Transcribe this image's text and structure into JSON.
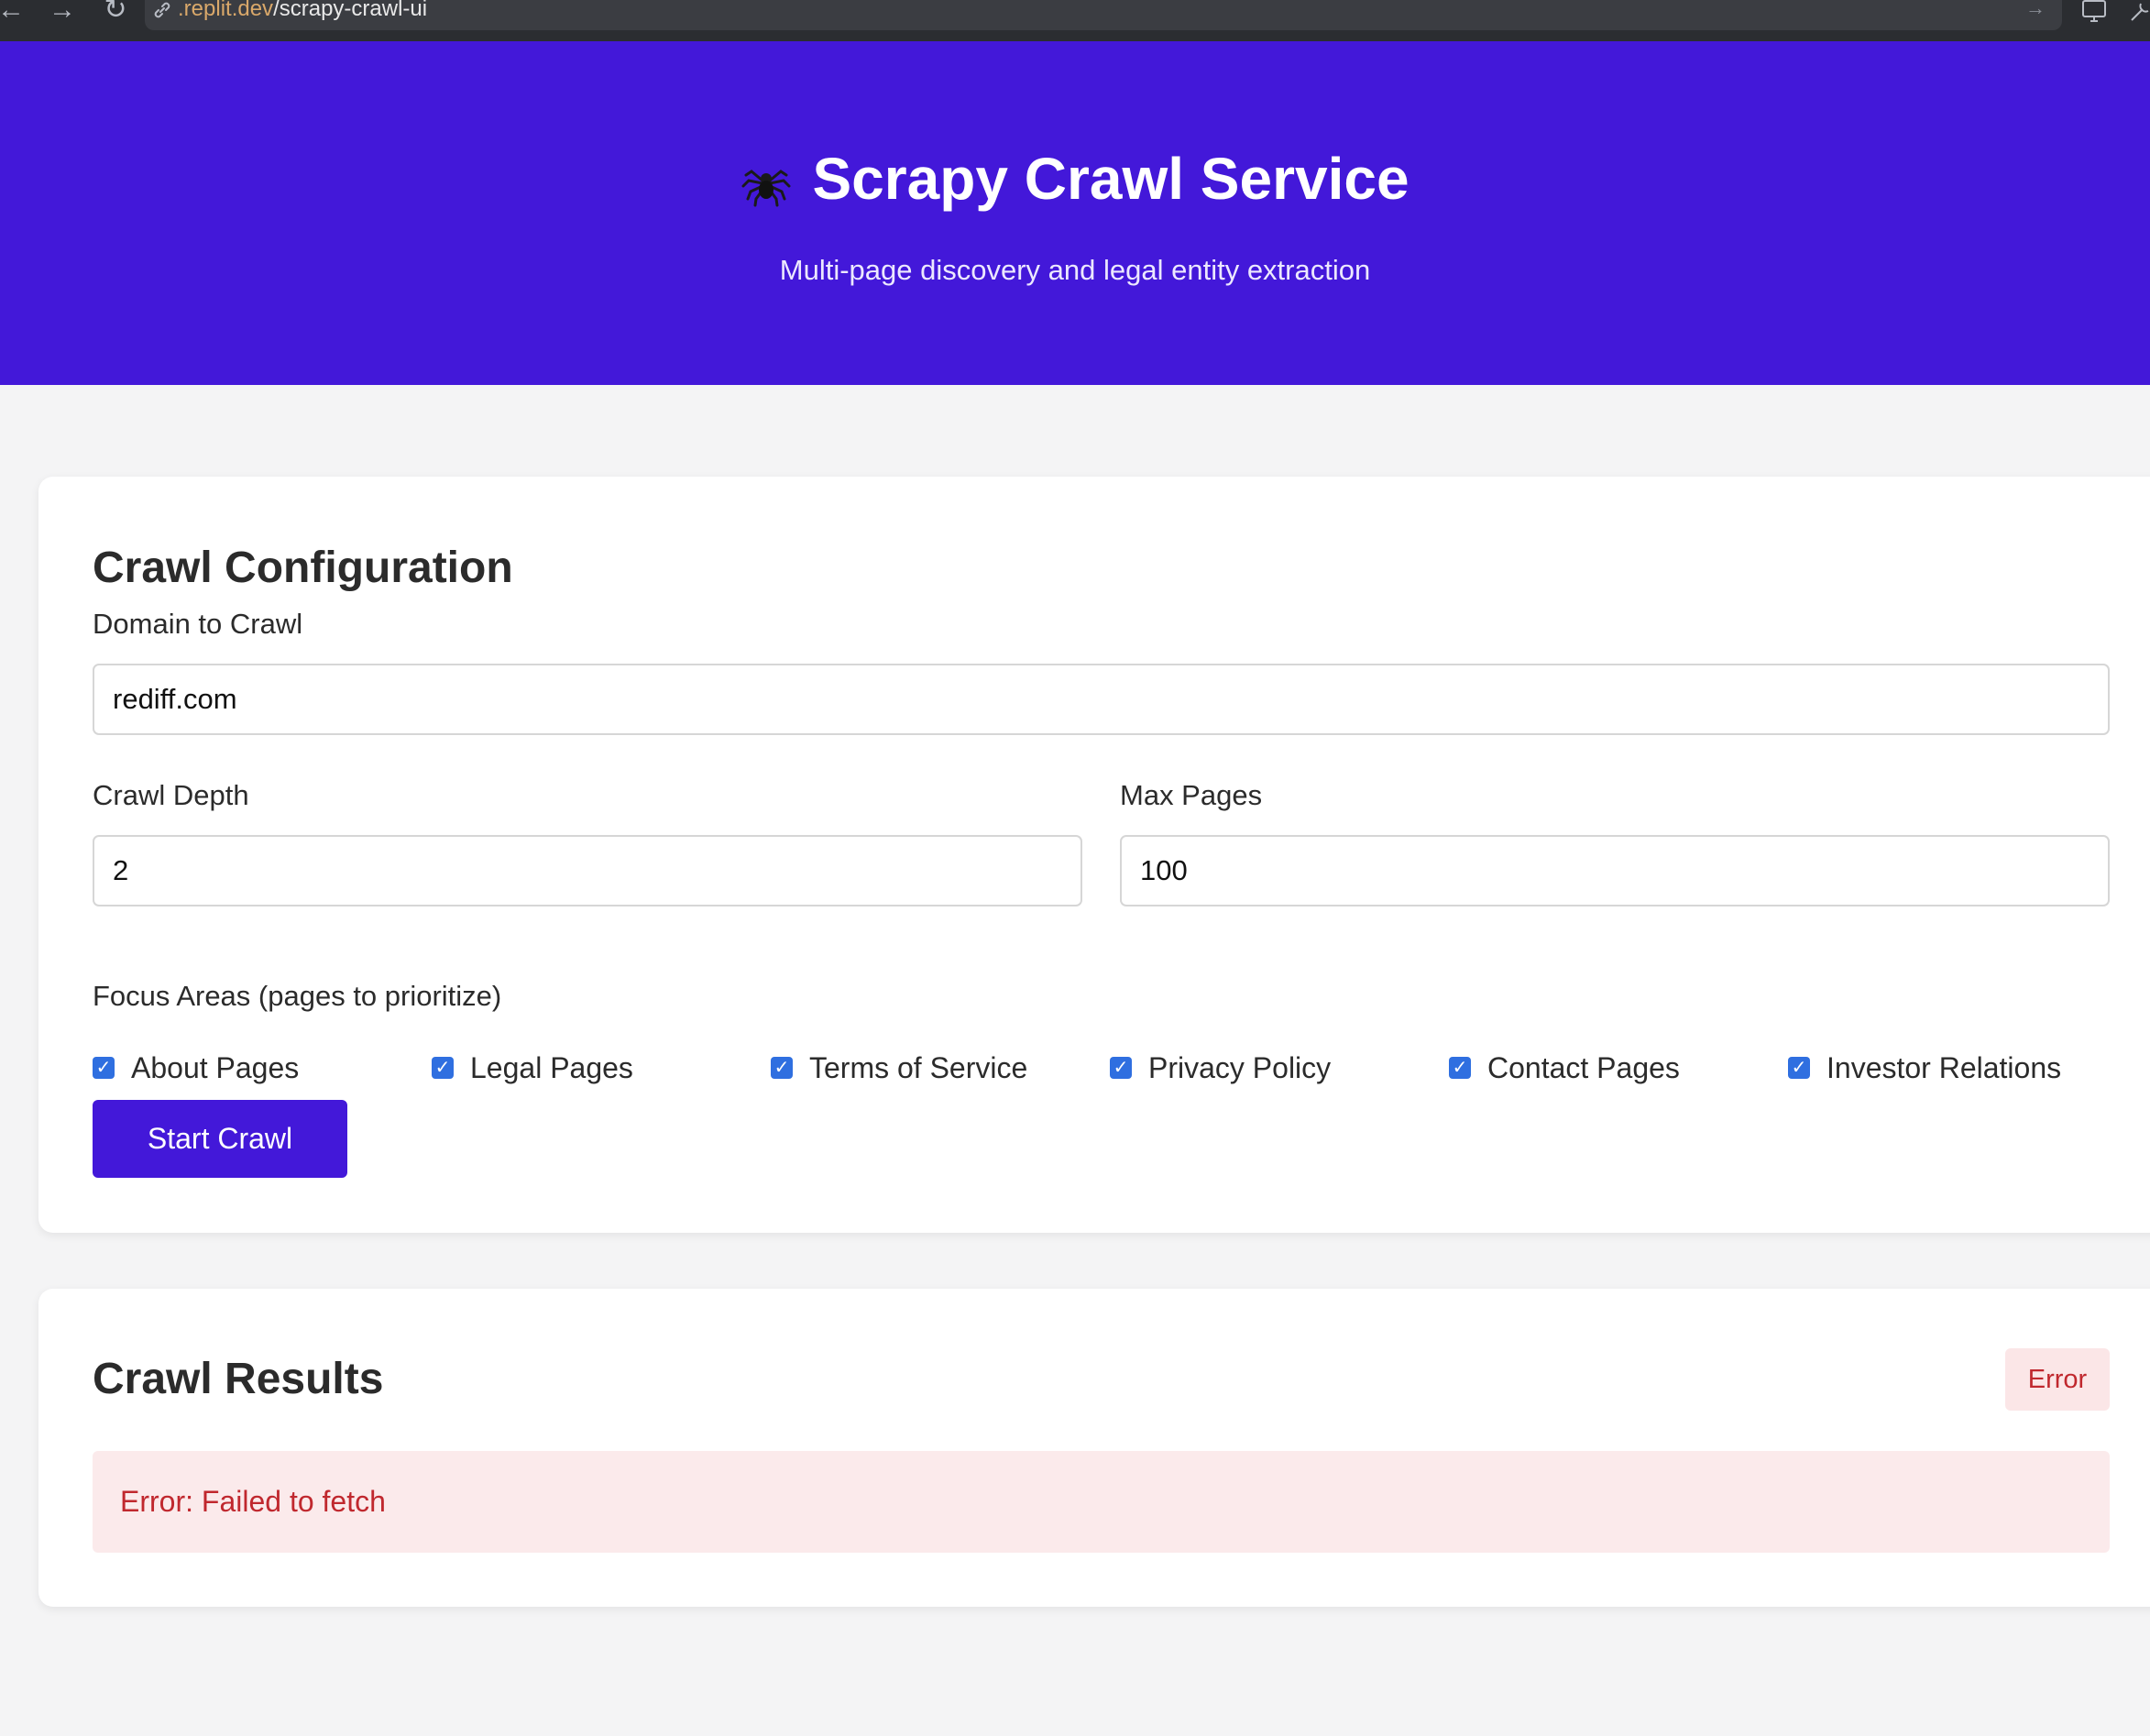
{
  "browser": {
    "url_domain": ".replit.dev",
    "url_path": "/scrapy-crawl-ui"
  },
  "header": {
    "icon": "spider-icon",
    "title": "Scrapy Crawl Service",
    "subtitle": "Multi-page discovery and legal entity extraction"
  },
  "config": {
    "title": "Crawl Configuration",
    "domain_label": "Domain to Crawl",
    "domain_value": "rediff.com",
    "depth_label": "Crawl Depth",
    "depth_value": "2",
    "max_pages_label": "Max Pages",
    "max_pages_value": "100",
    "focus_label": "Focus Areas (pages to prioritize)",
    "focus_areas": [
      {
        "label": "About Pages",
        "checked": true
      },
      {
        "label": "Legal Pages",
        "checked": true
      },
      {
        "label": "Terms of Service",
        "checked": true
      },
      {
        "label": "Privacy Policy",
        "checked": true
      },
      {
        "label": "Contact Pages",
        "checked": true
      },
      {
        "label": "Investor Relations",
        "checked": true
      }
    ],
    "start_button": "Start Crawl"
  },
  "results": {
    "title": "Crawl Results",
    "status": "Error",
    "error_message": "Error: Failed to fetch"
  },
  "colors": {
    "brand": "#4318d9",
    "checkbox": "#2f6fe0",
    "error_text": "#c0282e",
    "error_bg": "#fbeaeb"
  }
}
